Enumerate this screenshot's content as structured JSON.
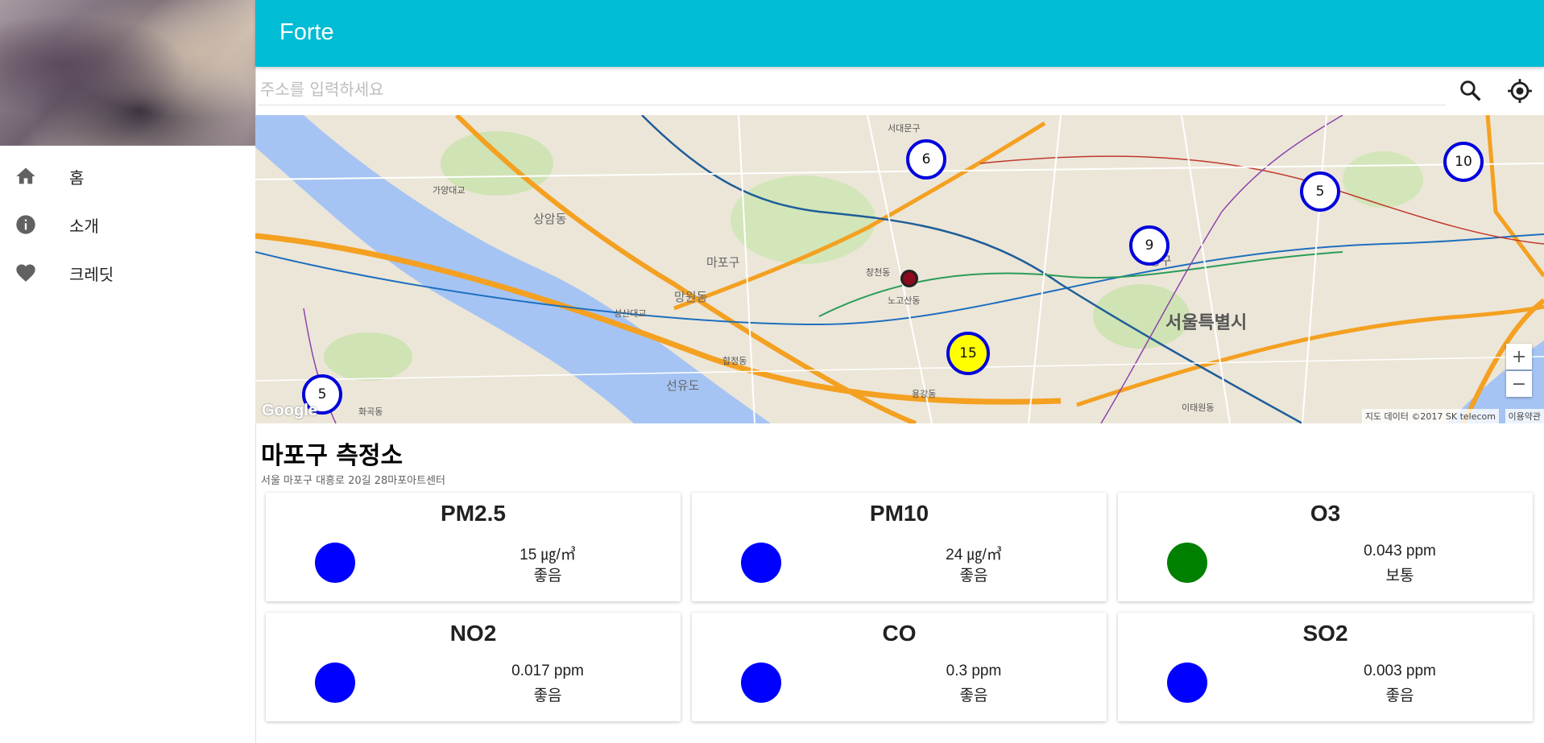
{
  "app": {
    "title": "Forte"
  },
  "sidebar": {
    "items": [
      {
        "label": "홈",
        "icon": "home-icon"
      },
      {
        "label": "소개",
        "icon": "info-icon"
      },
      {
        "label": "크레딧",
        "icon": "heart-icon"
      }
    ]
  },
  "search": {
    "placeholder": "주소를 입력하세요",
    "value": ""
  },
  "map": {
    "clusters": [
      {
        "count": "6",
        "highlight": false
      },
      {
        "count": "10",
        "highlight": false
      },
      {
        "count": "5",
        "highlight": false
      },
      {
        "count": "9",
        "highlight": false
      },
      {
        "count": "15",
        "highlight": true
      },
      {
        "count": "5",
        "highlight": false
      }
    ],
    "labels": {
      "seoul": "서울특별시",
      "mapo": "마포구",
      "sangam": "상암동",
      "mangwon": "망원동",
      "hapjeong": "합정동",
      "seongsan": "성산대교",
      "gayang": "가양대교",
      "seodaemun": "서대문구",
      "changcheon": "창천동",
      "nogosan": "노고산동",
      "jung": "중구",
      "seonyudo": "선유도",
      "itaewon": "이태원동",
      "hwagok": "화곡동",
      "yongsan": "용강동"
    },
    "zoom_in": "+",
    "zoom_out": "−",
    "attribution": "지도 데이터 ©2017 SK telecom",
    "terms": "이용약관",
    "google": "Google"
  },
  "station": {
    "name": "마포구 측정소",
    "address": "서울 마포구 대흥로 20길 28마포아트센터"
  },
  "colors": {
    "good": "#0000ff",
    "normal": "#008000",
    "accent": "#00bcd4"
  },
  "measurements": [
    {
      "name": "PM2.5",
      "value": "15 ㎍/㎥",
      "grade": "좋음",
      "color": "#0000ff"
    },
    {
      "name": "PM10",
      "value": "24 ㎍/㎥",
      "grade": "좋음",
      "color": "#0000ff"
    },
    {
      "name": "O3",
      "value": "0.043 ppm",
      "grade": "보통",
      "color": "#008000"
    },
    {
      "name": "NO2",
      "value": "0.017 ppm",
      "grade": "좋음",
      "color": "#0000ff"
    },
    {
      "name": "CO",
      "value": "0.3 ppm",
      "grade": "좋음",
      "color": "#0000ff"
    },
    {
      "name": "SO2",
      "value": "0.003 ppm",
      "grade": "좋음",
      "color": "#0000ff"
    }
  ]
}
